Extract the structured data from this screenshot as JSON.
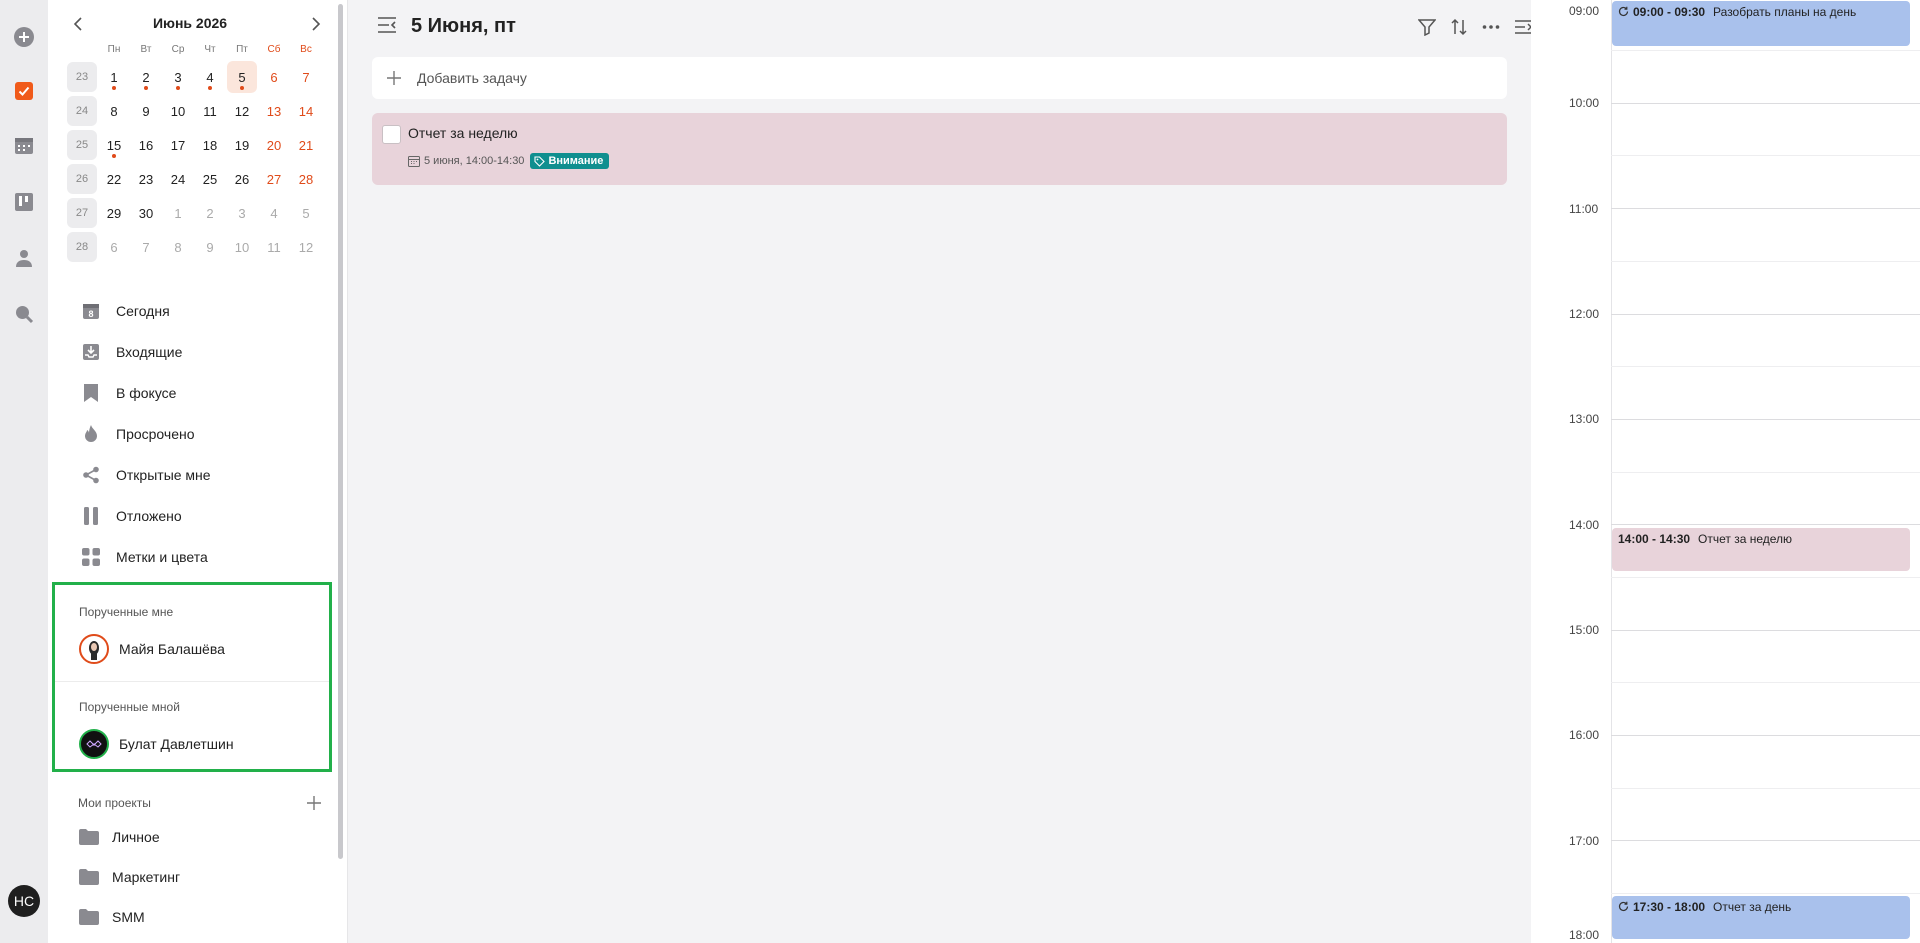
{
  "rail": {
    "avatar_initials": "НС"
  },
  "calendar": {
    "title": "Июнь 2026",
    "weekdays": [
      "Пн",
      "Вт",
      "Ср",
      "Чт",
      "Пт",
      "Сб",
      "Вс"
    ],
    "weeks": [
      {
        "num": "23",
        "days": [
          "1",
          "2",
          "3",
          "4",
          "5",
          "6",
          "7"
        ]
      },
      {
        "num": "24",
        "days": [
          "8",
          "9",
          "10",
          "11",
          "12",
          "13",
          "14"
        ]
      },
      {
        "num": "25",
        "days": [
          "15",
          "16",
          "17",
          "18",
          "19",
          "20",
          "21"
        ]
      },
      {
        "num": "26",
        "days": [
          "22",
          "23",
          "24",
          "25",
          "26",
          "27",
          "28"
        ]
      },
      {
        "num": "27",
        "days": [
          "29",
          "30",
          "1",
          "2",
          "3",
          "4",
          "5"
        ]
      },
      {
        "num": "28",
        "days": [
          "6",
          "7",
          "8",
          "9",
          "10",
          "11",
          "12"
        ]
      }
    ]
  },
  "nav": {
    "items": [
      {
        "label": "Сегодня",
        "icon": "today-icon"
      },
      {
        "label": "Входящие",
        "icon": "inbox-icon"
      },
      {
        "label": "В фокусе",
        "icon": "bookmark-icon"
      },
      {
        "label": "Просрочено",
        "icon": "flame-icon"
      },
      {
        "label": "Открытые мне",
        "icon": "share-icon"
      },
      {
        "label": "Отложено",
        "icon": "pause-icon"
      },
      {
        "label": "Метки и цвета",
        "icon": "grid-icon"
      }
    ]
  },
  "assigned": {
    "to_me_label": "Порученные мне",
    "to_me_person": "Майя Балашёва",
    "by_me_label": "Порученные мной",
    "by_me_person": "Булат Давлетшин"
  },
  "projects": {
    "label": "Мои проекты",
    "items": [
      "Личное",
      "Маркетинг",
      "SMM"
    ]
  },
  "main": {
    "title": "5 Июня, пт",
    "add_task_placeholder": "Добавить задачу",
    "task": {
      "title": "Отчет за неделю",
      "date": "5 июня, 14:00-14:30",
      "tag": "Внимание",
      "tag_color": "#0f8f8f",
      "background": "#e8d3da"
    }
  },
  "timeline": {
    "hours": [
      "09:00",
      "10:00",
      "11:00",
      "12:00",
      "13:00",
      "14:00",
      "15:00",
      "16:00",
      "17:00",
      "18:00"
    ],
    "events": [
      {
        "time": "09:00 - 09:30",
        "title": "Разобрать планы на день",
        "color": "#a9c1ec",
        "recurring": true
      },
      {
        "time": "14:00 - 14:30",
        "title": "Отчет за неделю",
        "color": "#e8d3da",
        "recurring": false
      },
      {
        "time": "17:30 - 18:00",
        "title": "Отчет за день",
        "color": "#a9c1ec",
        "recurring": true
      }
    ]
  },
  "colors": {
    "accent": "#e04b1a",
    "highlight_border": "#22b04a"
  }
}
